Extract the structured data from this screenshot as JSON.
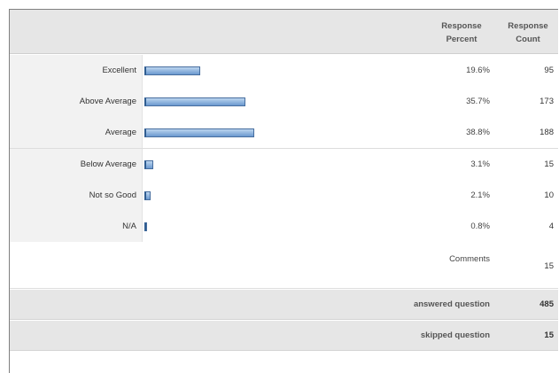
{
  "header": {
    "percent_label_line1": "Response",
    "percent_label_line2": "Percent",
    "count_label_line1": "Response",
    "count_label_line2": "Count"
  },
  "colors": {
    "bar_fill_top": "#bcd5ef",
    "bar_fill_bottom": "#6a98cf",
    "bar_border": "#476e9f",
    "header_bg": "#e6e6e6"
  },
  "chart_data": {
    "type": "bar",
    "orientation": "horizontal",
    "categories": [
      "Excellent",
      "Above Average",
      "Average",
      "Below Average",
      "Not so Good",
      "N/A"
    ],
    "values": [
      19.6,
      35.7,
      38.8,
      3.1,
      2.1,
      0.8
    ],
    "percent_labels": [
      "19.6%",
      "35.7%",
      "38.8%",
      "3.1%",
      "2.1%",
      "0.8%"
    ],
    "counts": [
      "95",
      "173",
      "188",
      "15",
      "10",
      "4"
    ]
  },
  "comments": {
    "label": "Comments",
    "count": "15"
  },
  "summary": {
    "answered_label": "answered question",
    "answered_value": "485",
    "skipped_label": "skipped question",
    "skipped_value": "15"
  }
}
